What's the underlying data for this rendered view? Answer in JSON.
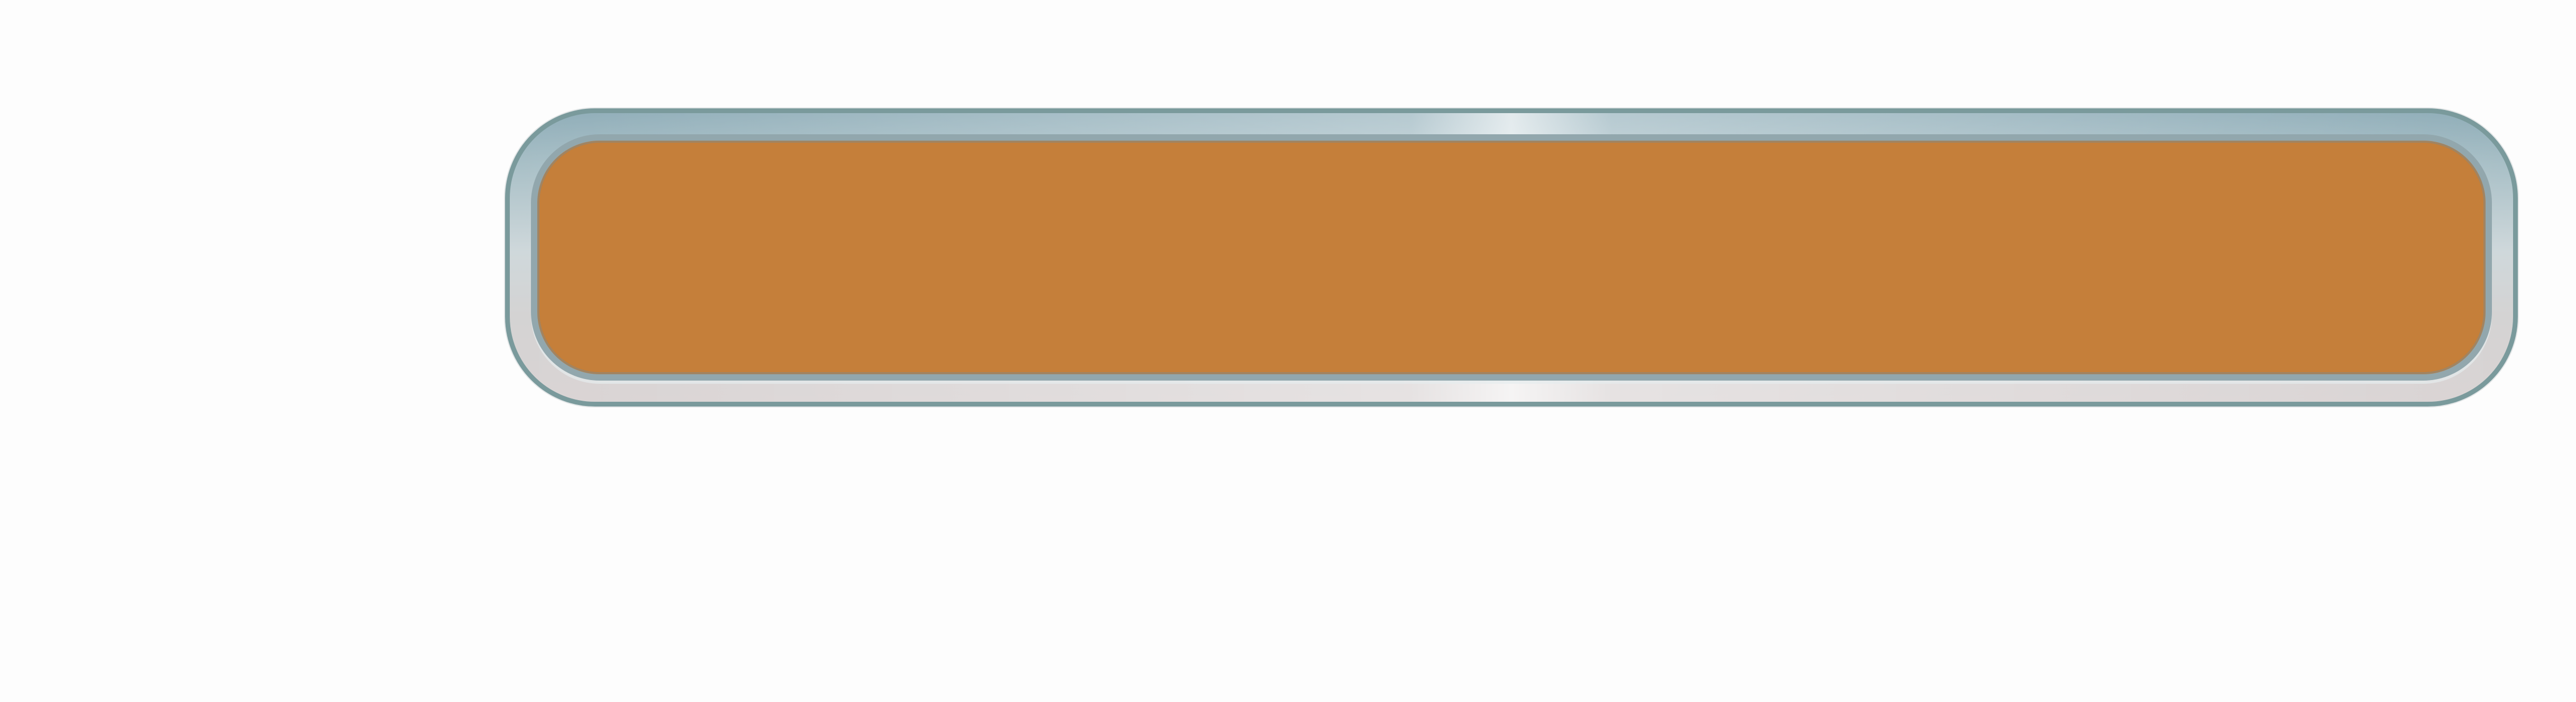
{
  "button": {
    "face_color": "#c57f3a",
    "frame_color": "#7a9a9c",
    "label": ""
  }
}
